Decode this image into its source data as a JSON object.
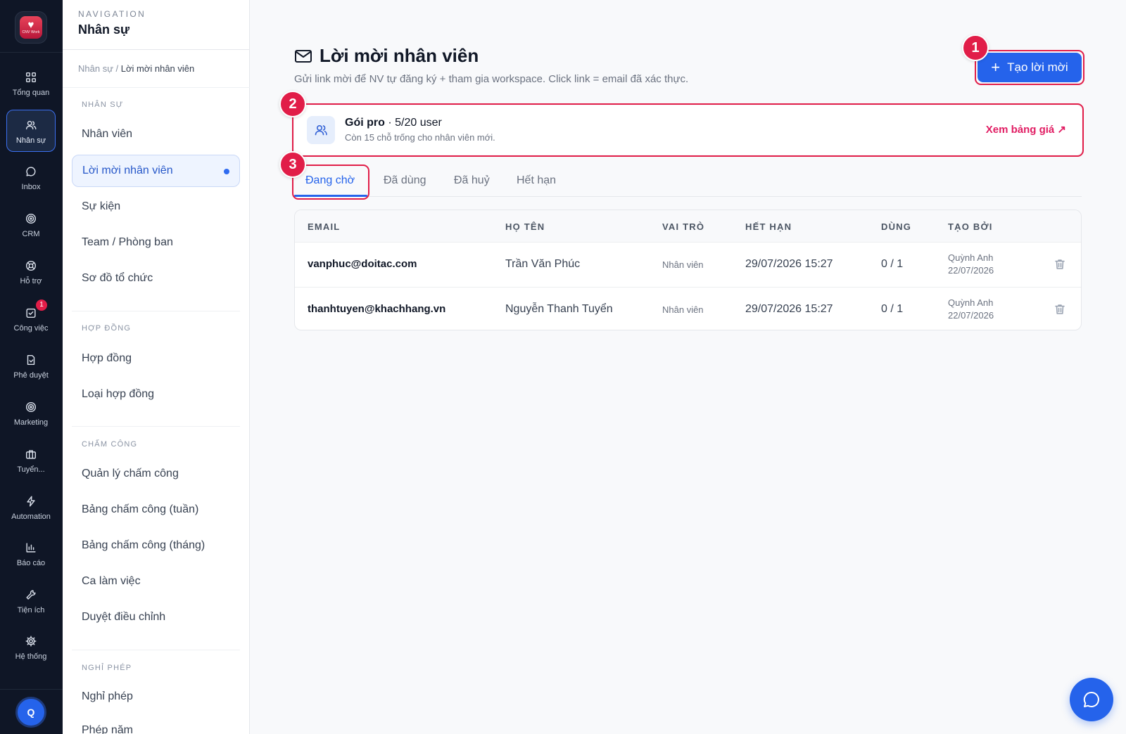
{
  "app": {
    "logo_text": "CNV Work"
  },
  "rail": {
    "items": [
      {
        "label": "Tổng quan",
        "icon": "grid-icon"
      },
      {
        "label": "Nhân sự",
        "icon": "users-icon"
      },
      {
        "label": "Inbox",
        "icon": "chat-icon"
      },
      {
        "label": "CRM",
        "icon": "target-icon"
      },
      {
        "label": "Hỗ trợ",
        "icon": "lifebuoy-icon"
      },
      {
        "label": "Công việc",
        "icon": "task-icon",
        "badge": "1"
      },
      {
        "label": "Phê duyệt",
        "icon": "file-check-icon"
      },
      {
        "label": "Marketing",
        "icon": "radar-icon"
      },
      {
        "label": "Tuyển...",
        "icon": "briefcase-icon"
      },
      {
        "label": "Automation",
        "icon": "bolt-icon"
      },
      {
        "label": "Báo cáo",
        "icon": "bar-chart-icon"
      },
      {
        "label": "Tiện ích",
        "icon": "wrench-icon"
      },
      {
        "label": "Hệ thống",
        "icon": "gear-icon"
      }
    ],
    "avatar_initial": "Q"
  },
  "subnav": {
    "eyebrow": "NAVIGATION",
    "title": "Nhân sự",
    "breadcrumb_parent": "Nhân sự /",
    "breadcrumb_current": "Lời mời nhân viên",
    "sections": [
      {
        "title": "NHÂN SỰ",
        "items": [
          "Nhân viên",
          "Lời mời nhân viên",
          "Sự kiện",
          "Team / Phòng ban",
          "Sơ đồ tổ chức"
        ]
      },
      {
        "title": "HỢP ĐỒNG",
        "items": [
          "Hợp đồng",
          "Loại hợp đồng"
        ]
      },
      {
        "title": "CHẤM CÔNG",
        "items": [
          "Quản lý chấm công",
          "Bảng chấm công (tuần)",
          "Bảng chấm công (tháng)",
          "Ca làm việc",
          "Duyệt điều chỉnh"
        ]
      },
      {
        "title": "NGHỈ PHÉP",
        "items": [
          "Nghỉ phép",
          "Phép năm"
        ]
      }
    ]
  },
  "main": {
    "title": "Lời mời nhân viên",
    "subtitle": "Gửi link mời để NV tự đăng ký + tham gia workspace. Click link = email đã xác thực.",
    "create_button": "Tạo lời mời",
    "plan": {
      "name_bold": "Gói pro",
      "name_rest": " · 5/20 user",
      "desc": "Còn 15 chỗ trống cho nhân viên mới.",
      "link": "Xem bảng giá ↗"
    },
    "tabs": [
      "Đang chờ",
      "Đã dùng",
      "Đã huỷ",
      "Hết hạn"
    ],
    "active_tab": "Đang chờ",
    "table": {
      "headers": [
        "EMAIL",
        "HỌ TÊN",
        "VAI TRÒ",
        "HẾT HẠN",
        "DÙNG",
        "TẠO BỞI"
      ],
      "rows": [
        {
          "email": "vanphuc@doitac.com",
          "name": "Trần Văn Phúc",
          "role": "Nhân viên",
          "expires": "29/07/2026 15:27",
          "used": "0 / 1",
          "created_by": "Quỳnh Anh",
          "created_at": "22/07/2026"
        },
        {
          "email": "thanhtuyen@khachhang.vn",
          "name": "Nguyễn Thanh Tuyển",
          "role": "Nhân viên",
          "expires": "29/07/2026 15:27",
          "used": "0 / 1",
          "created_by": "Quỳnh Anh",
          "created_at": "22/07/2026"
        }
      ]
    }
  },
  "annotations": [
    "1",
    "2",
    "3"
  ],
  "colors": {
    "accent": "#2563eb",
    "highlight": "#e11d48",
    "rail_bg": "#0f1626"
  }
}
